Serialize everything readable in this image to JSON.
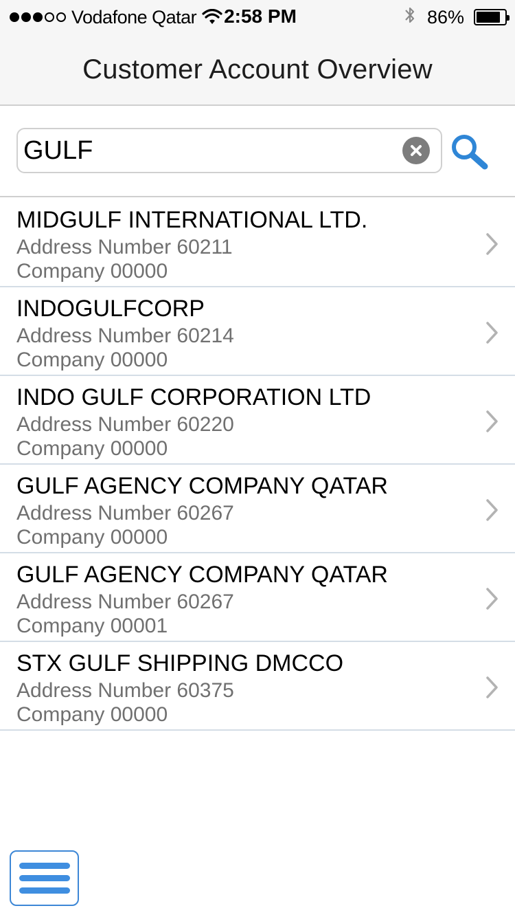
{
  "status_bar": {
    "carrier": "Vodafone Qatar",
    "time": "2:58 PM",
    "battery_percent": "86%",
    "battery_level": 0.86,
    "signal_bars_filled": 3,
    "signal_bars_total": 5,
    "icons": [
      "signal-dots-icon",
      "wifi-icon",
      "bluetooth-icon",
      "battery-icon"
    ]
  },
  "header": {
    "title": "Customer Account Overview"
  },
  "search": {
    "value": "GULF",
    "clear_icon": "clear-circle-icon",
    "search_icon": "magnifier-icon"
  },
  "results": [
    {
      "name": "MIDGULF INTERNATIONAL LTD.",
      "address": "Address Number 60211",
      "company": "Company 00000"
    },
    {
      "name": "INDOGULFCORP",
      "address": "Address Number 60214",
      "company": "Company 00000"
    },
    {
      "name": "INDO GULF CORPORATION LTD",
      "address": "Address Number 60220",
      "company": "Company 00000"
    },
    {
      "name": "GULF AGENCY COMPANY QATAR",
      "address": "Address Number 60267",
      "company": "Company 00000"
    },
    {
      "name": "GULF AGENCY COMPANY QATAR",
      "address": "Address Number 60267",
      "company": "Company 00001"
    },
    {
      "name": "STX GULF SHIPPING DMCCO",
      "address": "Address Number 60375",
      "company": "Company 00000"
    }
  ],
  "menu": {
    "icon": "hamburger-menu-icon"
  },
  "colors": {
    "accent": "#3f8ee0",
    "header_bg": "#f6f6f6",
    "secondary_text": "#707070",
    "divider": "#d4dde6"
  }
}
